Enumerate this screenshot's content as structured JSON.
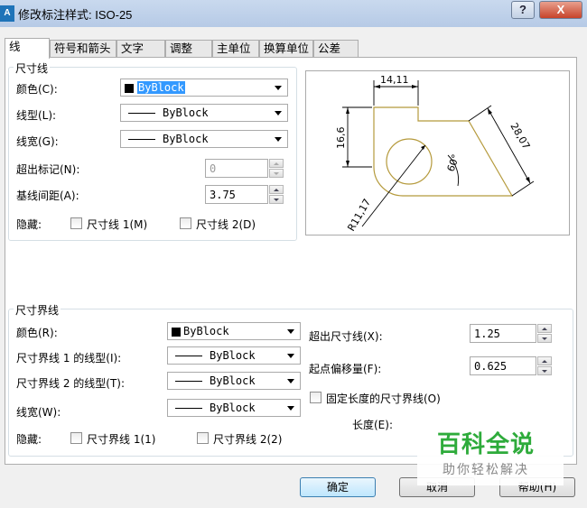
{
  "window": {
    "title": "修改标注样式: ISO-25",
    "app_icon_text": "A",
    "help_label": "?",
    "close_label": "X"
  },
  "tabs": [
    {
      "label": "线"
    },
    {
      "label": "符号和箭头"
    },
    {
      "label": "文字"
    },
    {
      "label": "调整"
    },
    {
      "label": "主单位"
    },
    {
      "label": "换算单位"
    },
    {
      "label": "公差"
    }
  ],
  "dim_line": {
    "title": "尺寸线",
    "color_label": "颜色(C):",
    "color_value": "ByBlock",
    "linetype_label": "线型(L):",
    "linetype_value": "ByBlock",
    "lineweight_label": "线宽(G):",
    "lineweight_value": "ByBlock",
    "extend_ticks_label": "超出标记(N):",
    "extend_ticks_value": "0",
    "baseline_spacing_label": "基线间距(A):",
    "baseline_spacing_value": "3.75",
    "suppress_label": "隐藏:",
    "suppress_1_label": "尺寸线 1(M)",
    "suppress_2_label": "尺寸线 2(D)"
  },
  "preview": {
    "dim_top": "14,11",
    "dim_left": "16,6",
    "dim_right": "28,07",
    "dim_angle": "60°",
    "dim_radius": "R11,17"
  },
  "ext_line": {
    "title": "尺寸界线",
    "color_label": "颜色(R):",
    "color_value": "ByBlock",
    "linetype1_label": "尺寸界线 1 的线型(I):",
    "linetype1_value": "ByBlock",
    "linetype2_label": "尺寸界线 2 的线型(T):",
    "linetype2_value": "ByBlock",
    "lineweight_label": "线宽(W):",
    "lineweight_value": "ByBlock",
    "suppress_label": "隐藏:",
    "suppress_1_label": "尺寸界线 1(1)",
    "suppress_2_label": "尺寸界线 2(2)",
    "extend_beyond_label": "超出尺寸线(X):",
    "extend_beyond_value": "1.25",
    "offset_label": "起点偏移量(F):",
    "offset_value": "0.625",
    "fixed_length_label": "固定长度的尺寸界线(O)",
    "length_label": "长度(E):"
  },
  "buttons": {
    "ok": "确定",
    "cancel": "取消",
    "help": "帮助(H)"
  },
  "watermark": {
    "brand": "百科全说",
    "slogan": "助你轻松解决"
  },
  "colors": {
    "selection": "#3399ff",
    "preview_outline": "#b59a3c",
    "watermark_green": "#2eab3b"
  }
}
